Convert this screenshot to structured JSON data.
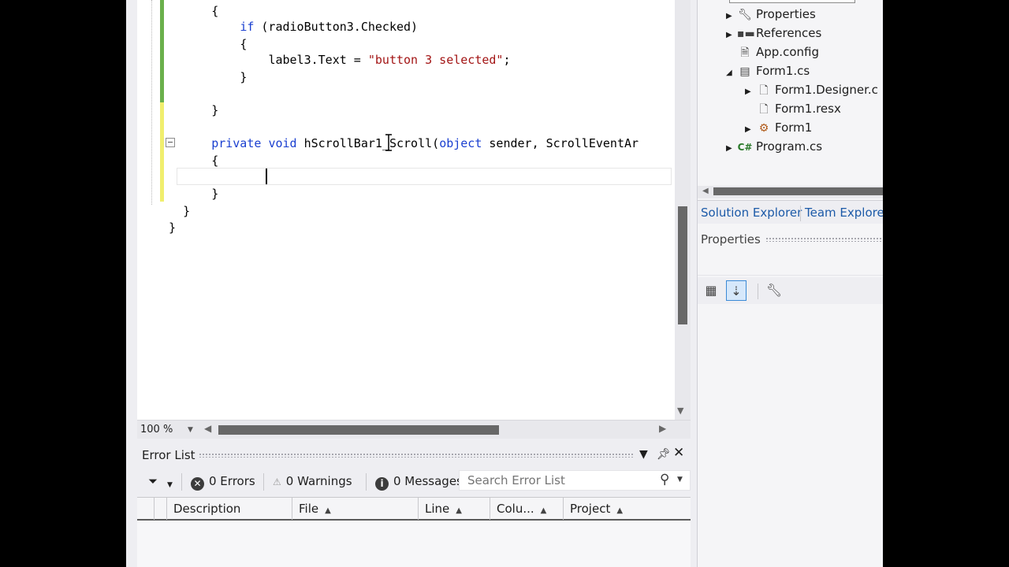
{
  "editor": {
    "code_lines": [
      {
        "indent": "      ",
        "text": "{"
      },
      {
        "indent": "          ",
        "kw": "if",
        "text": " (radioButton3.Checked)"
      },
      {
        "indent": "          ",
        "text": "{"
      },
      {
        "indent": "              ",
        "pre": "label3.Text = ",
        "str": "\"button 3 selected\"",
        "post": ";"
      },
      {
        "indent": "          ",
        "text": "}"
      },
      {
        "indent": "",
        "text": ""
      },
      {
        "indent": "      ",
        "text": "}"
      },
      {
        "indent": "",
        "text": ""
      },
      {
        "indent": "      ",
        "kw1": "private",
        "kw2": "void",
        "pre": " hScrollBar1_Scroll(",
        "kw3": "object",
        "post": " sender, ScrollEventAr"
      },
      {
        "indent": "      ",
        "text": "{"
      },
      {
        "indent": "",
        "text": ""
      },
      {
        "indent": "      ",
        "text": "}"
      },
      {
        "indent": "  ",
        "text": "}"
      },
      {
        "indent": "",
        "text": "}"
      }
    ],
    "zoom_label": "100 %"
  },
  "error_list": {
    "title": "Error List",
    "errors_label": "0 Errors",
    "warnings_label": "0 Warnings",
    "messages_label": "0 Messages",
    "search_placeholder": "Search Error List",
    "columns": [
      "Description",
      "File",
      "Line",
      "Colu...",
      "Project"
    ]
  },
  "solution_explorer": {
    "items": [
      {
        "label": "Properties",
        "icon": "wrench-icon"
      },
      {
        "label": "References",
        "icon": "references-icon"
      },
      {
        "label": "App.config",
        "icon": "config-file-icon"
      },
      {
        "label": "Form1.cs",
        "icon": "form-icon"
      },
      {
        "label": "Form1.Designer.c",
        "icon": "cs-file-icon"
      },
      {
        "label": "Form1.resx",
        "icon": "resx-file-icon"
      },
      {
        "label": "Form1",
        "icon": "class-icon"
      },
      {
        "label": "Program.cs",
        "icon": "csharp-file-icon"
      }
    ],
    "tabs": [
      "Solution Explorer",
      "Team Explorer"
    ]
  },
  "properties": {
    "title": "Properties"
  },
  "colors": {
    "keyword": "#1a3fd0",
    "string": "#a31515",
    "accent": "#1c5aa8",
    "changed_green": "#6ab04c",
    "changed_yellow": "#f0ee6e"
  }
}
